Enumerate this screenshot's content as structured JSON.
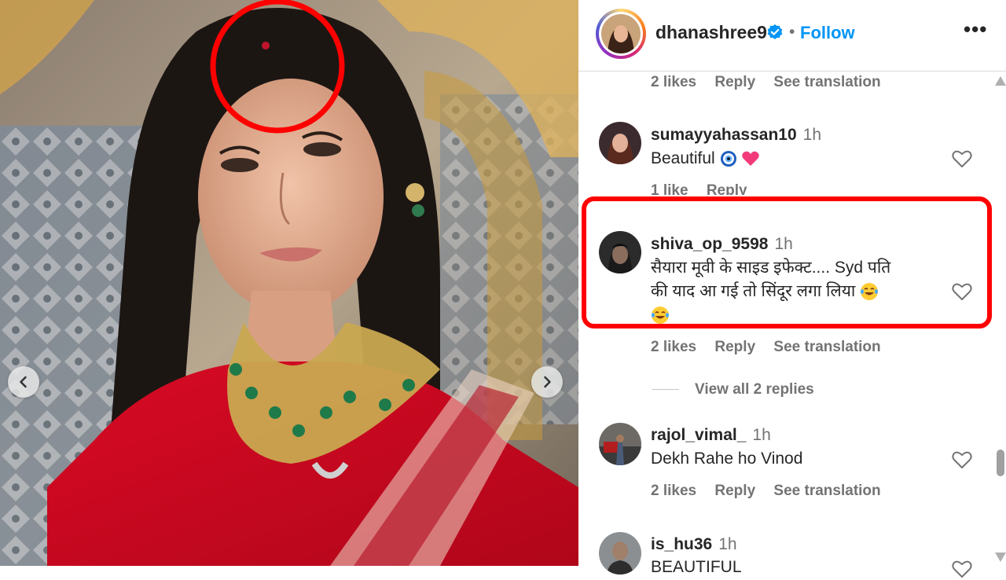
{
  "post": {
    "username": "dhanashree9",
    "follow_label": "Follow",
    "separator": "•",
    "more_label": "•••"
  },
  "carousel": {
    "prev_icon": "chevron-left-icon",
    "next_icon": "chevron-right-icon"
  },
  "comments": [
    {
      "meta": {
        "likes": "2 likes",
        "reply": "Reply",
        "translation": "See translation"
      }
    },
    {
      "username": "sumayyahassan10",
      "time": "1h",
      "text": "Beautiful",
      "emojis": [
        "nazar-icon",
        "heart-icon"
      ],
      "meta": {
        "likes": "1 like",
        "reply": "Reply"
      }
    },
    {
      "username": "shiva_op_9598",
      "time": "1h",
      "text_line1": "सैयारा मूवी के साइड इफेक्ट.... Syd पति",
      "text_line2": "की याद आ गई तो सिंदूर लगा लिया",
      "emojis": [
        "laughing-tears-icon",
        "laughing-tears-icon"
      ],
      "meta": {
        "likes": "2 likes",
        "reply": "Reply",
        "translation": "See translation"
      },
      "view_replies": "View all 2 replies"
    },
    {
      "username": "rajol_vimal_",
      "time": "1h",
      "text": "Dekh Rahe ho Vinod",
      "meta": {
        "likes": "2 likes",
        "reply": "Reply",
        "translation": "See translation"
      }
    },
    {
      "username": "is_hu36",
      "time": "1h",
      "text": "BEAUTIFUL"
    }
  ],
  "colors": {
    "link_blue": "#0095f6",
    "highlight_red": "#ff0000",
    "saree_red": "#e0102a",
    "muted_text": "#737373"
  }
}
